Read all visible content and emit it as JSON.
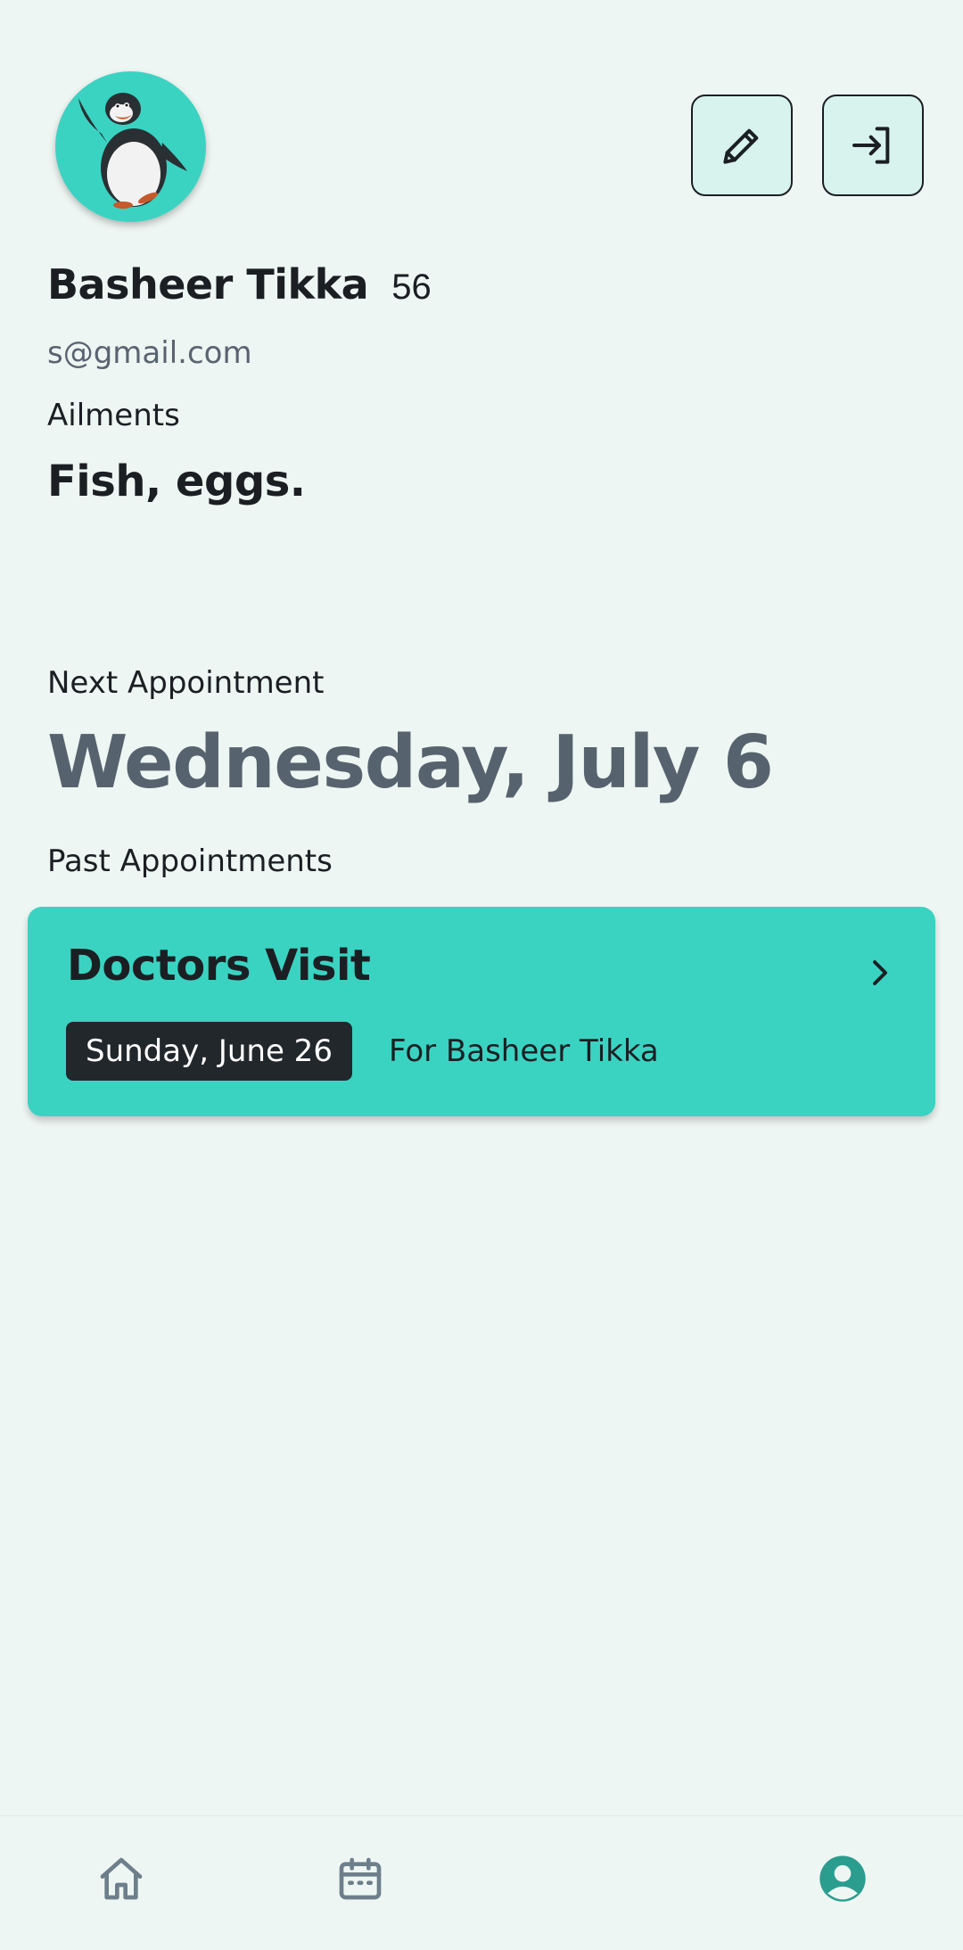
{
  "profile": {
    "name": "Basheer Tikka",
    "age": "56",
    "email": "s@gmail.com",
    "ailments_label": "Ailments",
    "ailments": "Fish, eggs.",
    "avatar_icon": "penguin-avatar"
  },
  "toolbar": {
    "edit_icon": "pencil-icon",
    "logout_icon": "sign-in-arrow-icon"
  },
  "next_appointment": {
    "label": "Next Appointment",
    "date": "Wednesday, July 6"
  },
  "past_appointments": {
    "label": "Past Appointments",
    "items": [
      {
        "title": "Doctors Visit",
        "date": "Sunday, June 26",
        "for": "For Basheer Tikka"
      }
    ]
  },
  "bottom_nav": {
    "items": [
      {
        "icon": "home-icon",
        "active": false
      },
      {
        "icon": "calendar-icon",
        "active": false
      },
      {
        "icon": "profile-icon",
        "active": true
      }
    ]
  },
  "colors": {
    "background": "#eef6f3",
    "accent": "#3ad3c2",
    "active_nav": "#2a9d8f",
    "inactive_nav": "#6d7f8a",
    "date_heading": "#56636e"
  }
}
